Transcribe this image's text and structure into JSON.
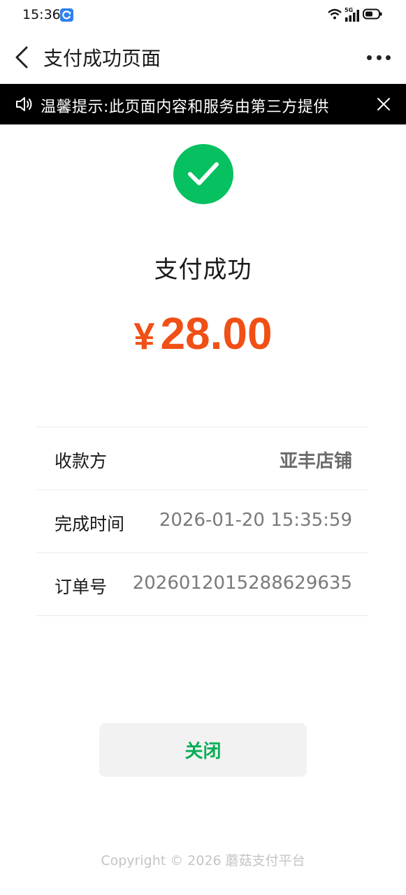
{
  "status_bar": {
    "time": "15:36",
    "network_badge": "5G"
  },
  "nav": {
    "title": "支付成功页面",
    "back_icon": "chevron-left-icon",
    "more_icon": "more-dots-icon"
  },
  "notice": {
    "text": "温馨提示:此页面内容和服务由第三方提供",
    "speaker_icon": "speaker-icon",
    "close_icon": "close-icon"
  },
  "result": {
    "icon": "check-circle-icon",
    "title": "支付成功",
    "currency": "¥",
    "amount": "28.00",
    "accent_color": "#07c160",
    "amount_color": "#f04f16"
  },
  "details": [
    {
      "label": "收款方",
      "value": "亚丰店铺"
    },
    {
      "label": "完成时间",
      "value": "2026-01-20 15:35:59"
    },
    {
      "label": "订单号",
      "value": "202601201528862963 5"
    }
  ],
  "close_button": {
    "label": "关闭"
  },
  "footer": {
    "copyright": "Copyright © 2026 蘑菇支付平台"
  }
}
